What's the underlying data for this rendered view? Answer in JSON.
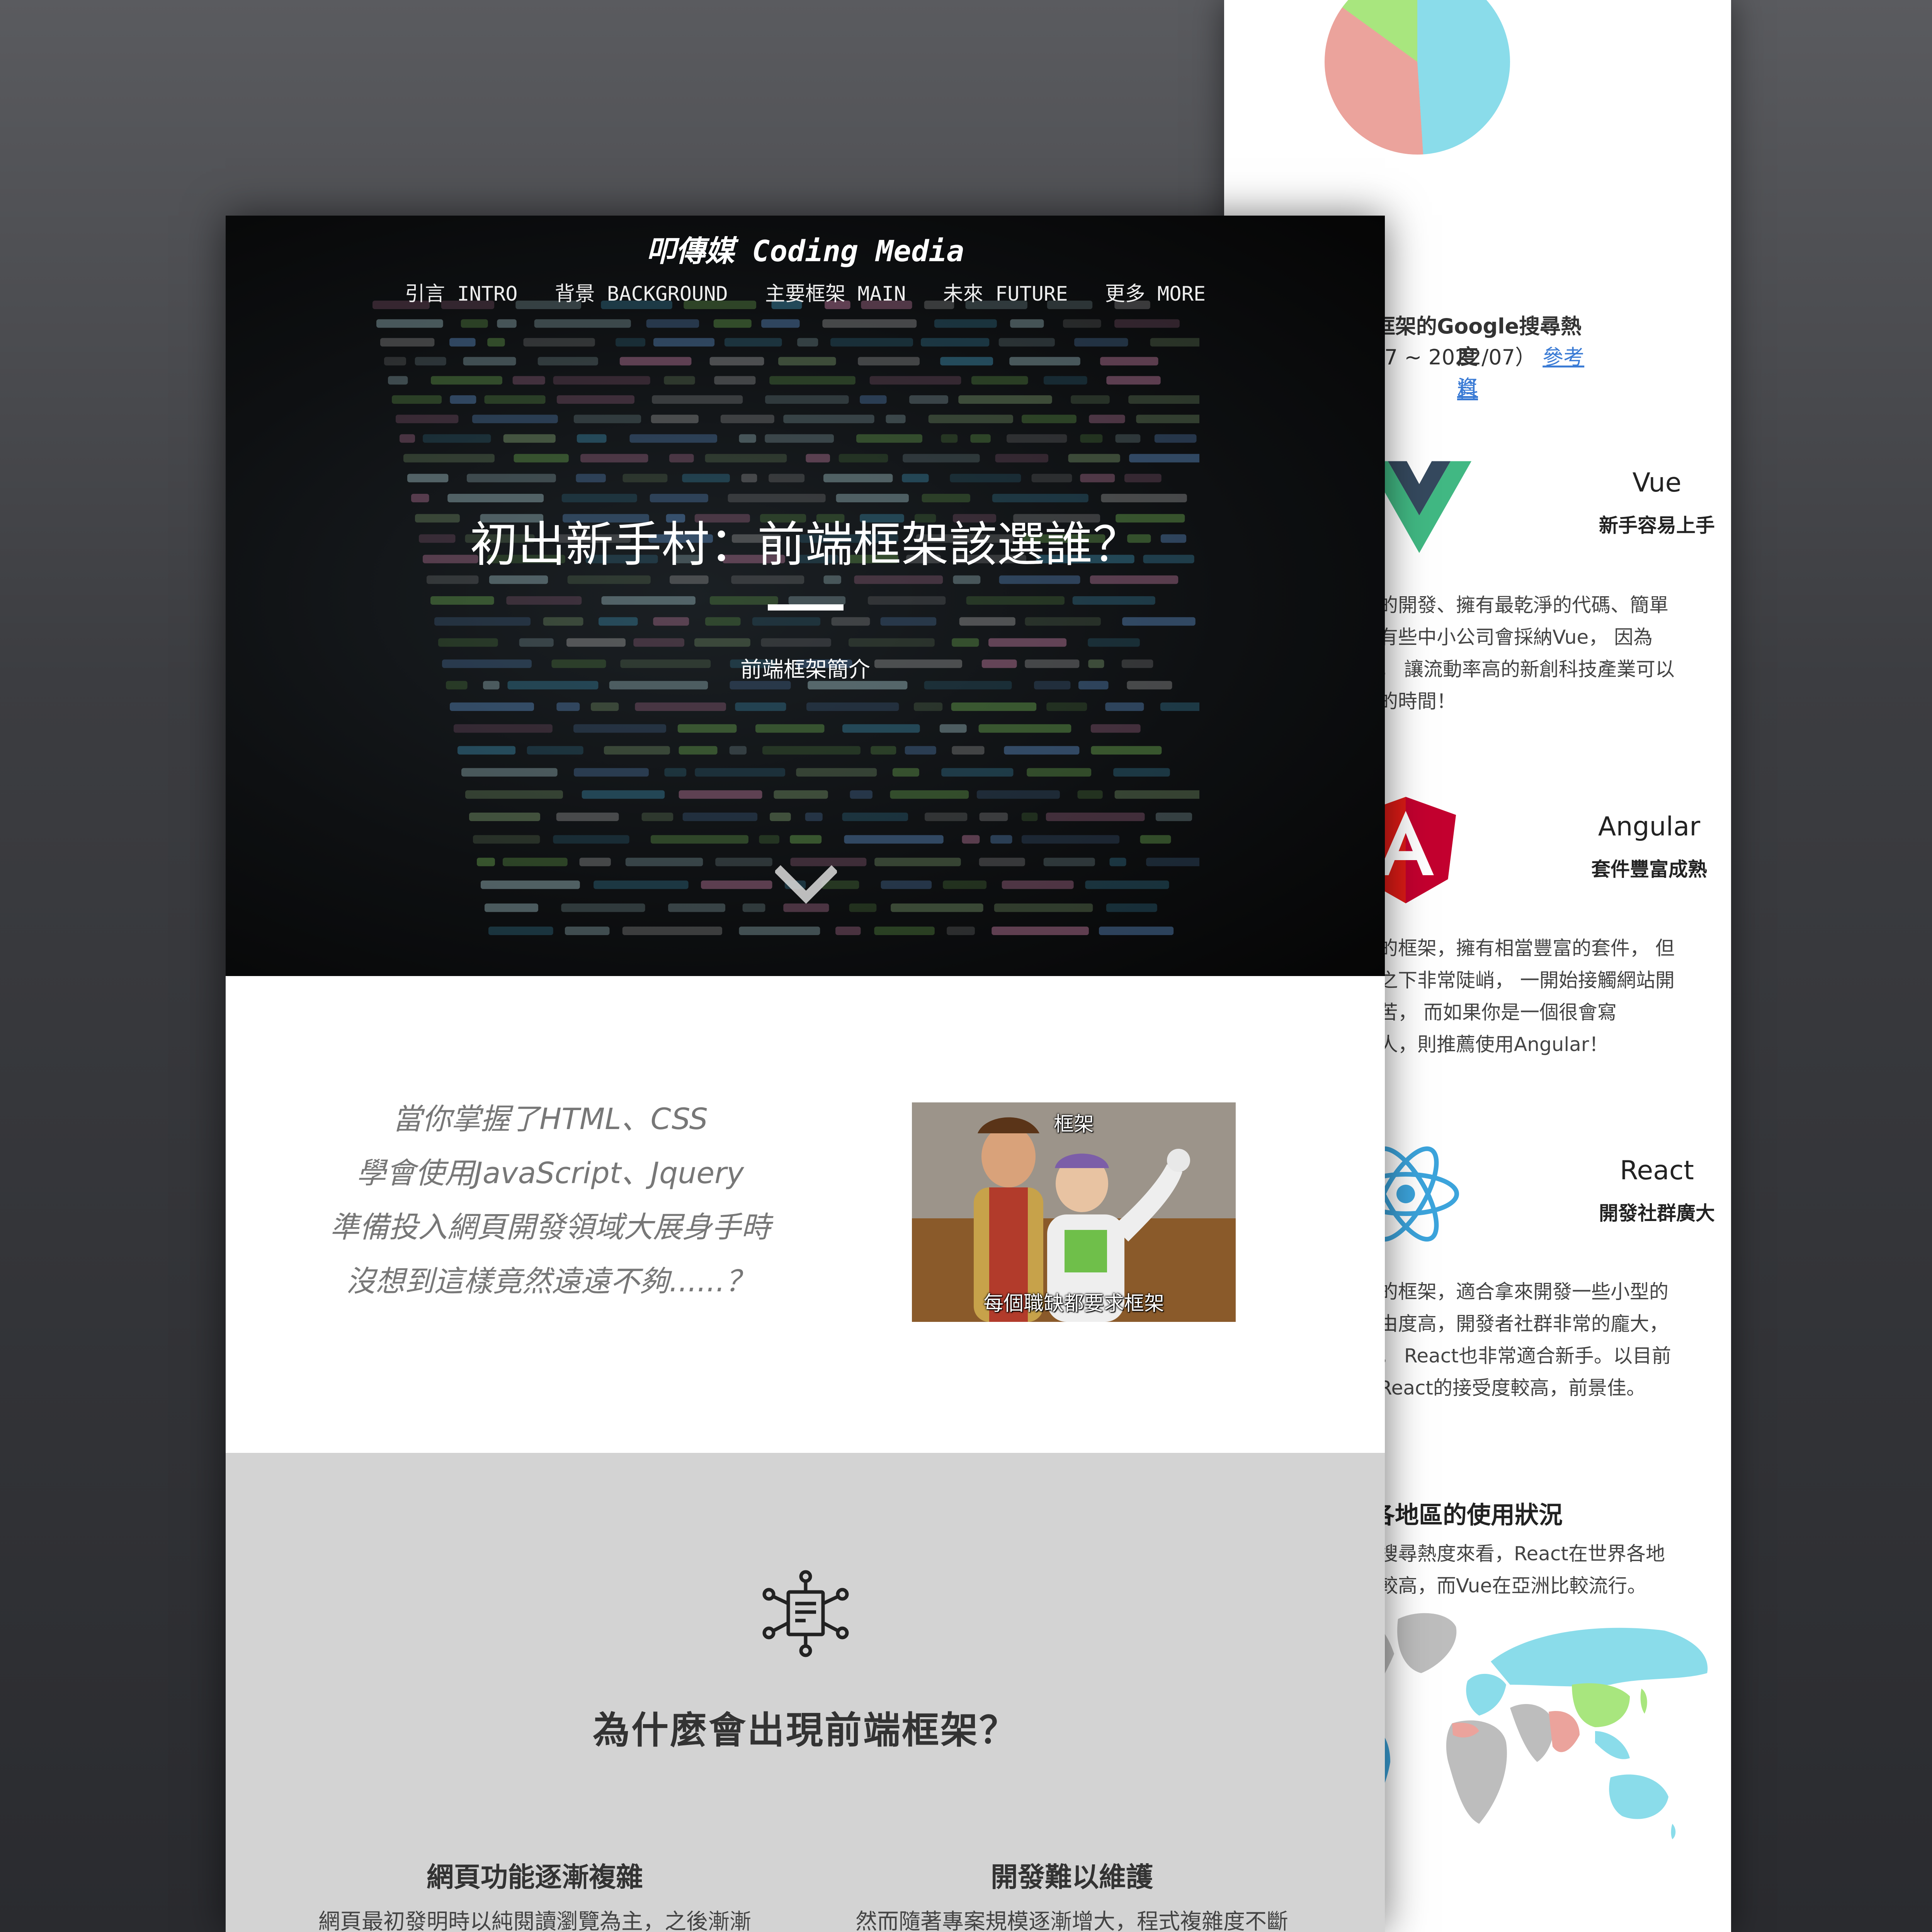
{
  "right_page": {
    "pie": {
      "slices": [
        {
          "name": "",
          "share": 0.49,
          "color": "#8adcea"
        },
        {
          "name": "",
          "share": 0.36,
          "color": "#eba39c"
        },
        {
          "name": "",
          "share": 0.15,
          "color": "#a8e67e"
        }
      ]
    },
    "pie_caption": {
      "line1": "端框架的Google搜尋熱度",
      "line2_prefix": "7/07 ~ 2022/07）",
      "line2_link": "參考資",
      "line3_link": "料"
    },
    "frameworks": [
      {
        "name": "Vue",
        "tagline": "新手容易上手",
        "logo_icon": "vue-logo-icon",
        "color": "#41b883",
        "desc": [
          "的開發、擁有最乾淨的代碼、簡單",
          "有些中小公司會採納Vue， 因為",
          "， 讓流動率高的新創科技產業可以",
          "的時間！"
        ]
      },
      {
        "name": "Angular",
        "tagline": "套件豐富成熟",
        "logo_icon": "angular-logo-icon",
        "color": "#dd1b16",
        "desc": [
          "的框架，擁有相當豐富的套件， 但",
          "之下非常陡峭， 一開始接觸網站開",
          "苦， 而如果你是一個很會寫",
          "人，則推薦使用Angular！"
        ]
      },
      {
        "name": "React",
        "tagline": "開發社群廣大",
        "logo_icon": "react-logo-icon",
        "color": "#3ca4dc",
        "desc": [
          "的框架，適合拿來開發一些小型的",
          "由度高，開發者社群非常的龐大，",
          "。 React也非常適合新手。以目前",
          "React的接受度較高，前景佳。"
        ]
      }
    ],
    "region": {
      "title": "各地區的使用狀況",
      "desc": [
        "搜尋熱度來看，React在世界各地",
        "較高，而Vue在亞洲比較流行。"
      ],
      "map_icon": "world-map-icon"
    }
  },
  "main_page": {
    "brand": "叩傳媒 Coding Media",
    "nav": [
      "引言 INTRO",
      "背景 BACKGROUND",
      "主要框架 MAIN",
      "未來 FUTURE",
      "更多 MORE"
    ],
    "hero_title": "初出新手村：前端框架該選誰？",
    "hero_subtitle": "前端框架簡介",
    "hero_scroll_icon": "chevron-down-icon",
    "intro_quote": [
      "當你掌握了HTML、CSS",
      "學會使用JavaScript、Jquery",
      "準備投入網頁開發領域大展身手時",
      "沒想到這樣竟然遠遠不夠......？"
    ],
    "meme": {
      "top": "框架",
      "bottom": "每個職缺都要求框架"
    },
    "why_icon": "network-document-icon",
    "why_title": "為什麼會出現前端框架？",
    "columns": [
      {
        "title": "網頁功能逐漸複雜",
        "text": "網頁最初發明時以純閱讀瀏覽為主，之後漸漸"
      },
      {
        "title": "開發難以維護",
        "text": "然而隨著專案規模逐漸增大，程式複雜度不斷"
      }
    ]
  }
}
